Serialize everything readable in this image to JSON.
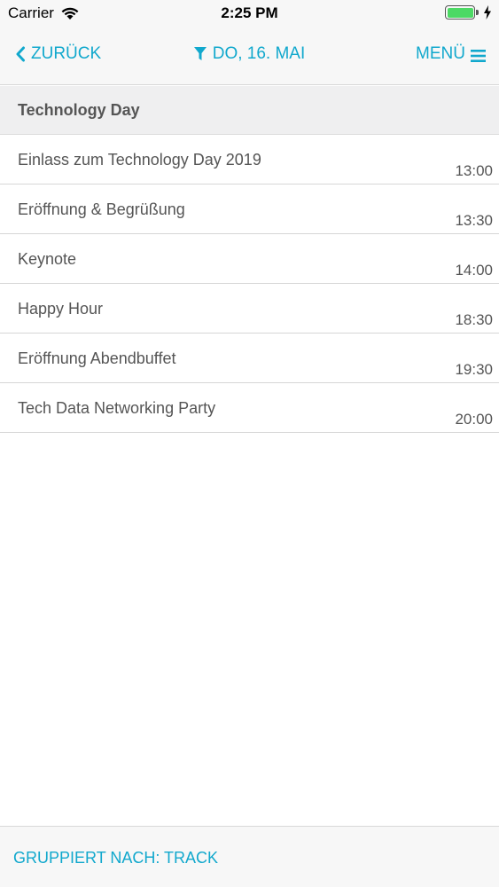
{
  "status_bar": {
    "carrier": "Carrier",
    "time": "2:25 PM",
    "battery_color": "#4cd964"
  },
  "nav": {
    "back_label": "ZURÜCK",
    "date_label": "DO, 16. MAI",
    "menu_label": "MENÜ",
    "accent_color": "#11a8cd",
    "icons": [
      "chevron-left-icon",
      "filter-icon",
      "hamburger-icon"
    ]
  },
  "section": {
    "title": "Technology Day"
  },
  "events": [
    {
      "title": "Einlass zum Technology Day 2019",
      "time": "13:00"
    },
    {
      "title": "Eröffnung & Begrüßung",
      "time": "13:30"
    },
    {
      "title": "Keynote",
      "time": "14:00"
    },
    {
      "title": "Happy Hour",
      "time": "18:30"
    },
    {
      "title": "Eröffnung Abendbuffet",
      "time": "19:30"
    },
    {
      "title": "Tech Data Networking Party",
      "time": "20:00"
    }
  ],
  "footer": {
    "group_label": "GRUPPIERT NACH: TRACK"
  }
}
